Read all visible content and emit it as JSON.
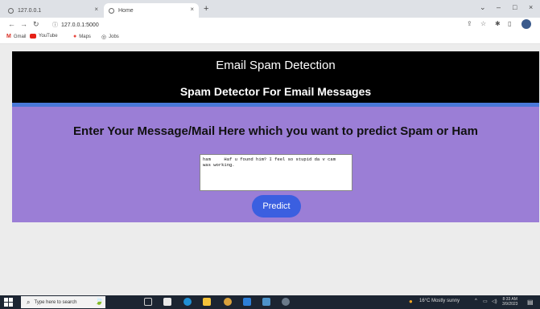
{
  "browser": {
    "tabs": [
      {
        "label": "127.0.0.1",
        "close": "×"
      },
      {
        "label": "Home",
        "close": "×"
      }
    ],
    "new_tab": "+",
    "window_controls": {
      "chevron": "⌄",
      "minimize": "–",
      "maximize": "□",
      "close": "×"
    },
    "url": "127.0.0.1:5000",
    "bookmarks": [
      {
        "label": "Gmail",
        "icon": "gmail-icon"
      },
      {
        "label": "YouTube",
        "icon": "youtube-icon"
      },
      {
        "label": "Maps",
        "icon": "maps-icon"
      },
      {
        "label": "Jobs",
        "icon": "globe-icon"
      }
    ]
  },
  "page": {
    "title": "Email Spam Detection",
    "subtitle": "Spam Detector For Email Messages",
    "prompt": "Enter Your Message/Mail Here which you want to predict Spam or Ham",
    "message_value": "ham\tHaf u found him? I feel so stupid da v cam\nwas working.",
    "predict_label": "Predict"
  },
  "taskbar": {
    "search_placeholder": "Type here to search",
    "weather": "16°C  Mostly sunny",
    "time": "8:33 AM",
    "date": "3/9/2023"
  },
  "colors": {
    "header_bg": "#000000",
    "accent_line": "#4a78d8",
    "main_bg": "#9b7ed6",
    "button_bg": "#3b5fe0"
  }
}
